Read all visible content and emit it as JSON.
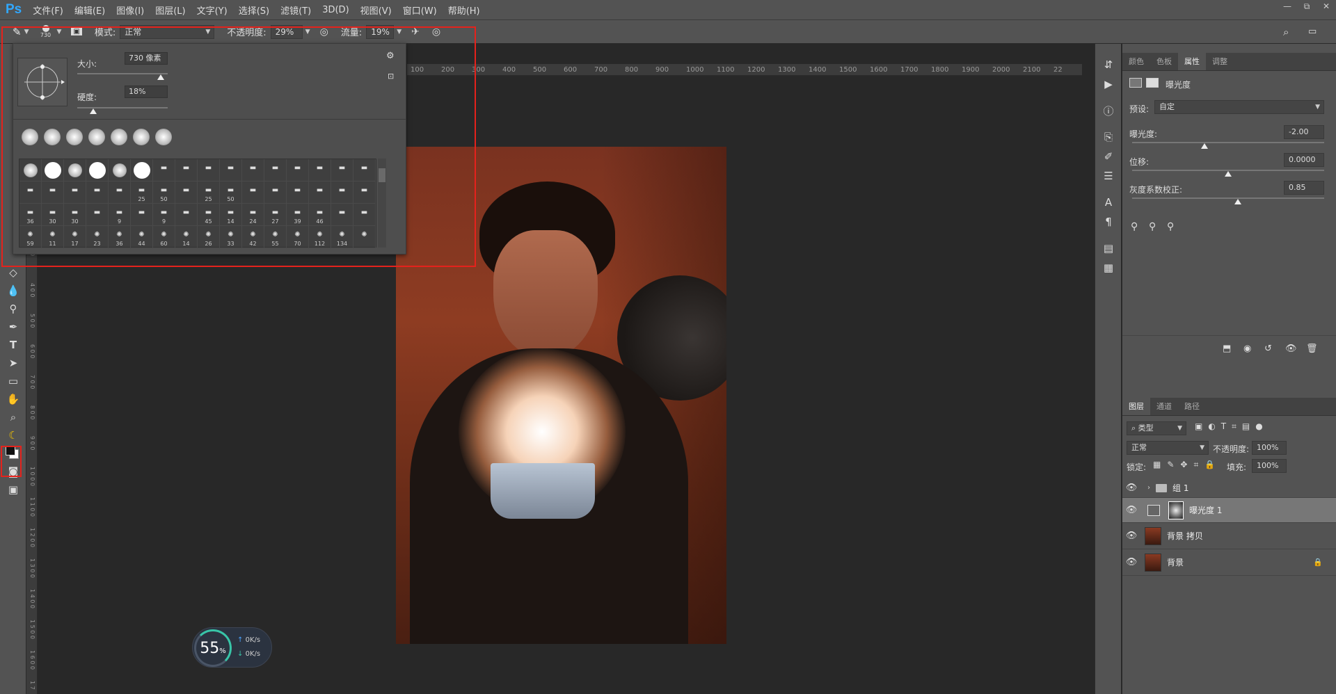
{
  "app": {
    "logo": "Ps",
    "menus": [
      "文件(F)",
      "编辑(E)",
      "图像(I)",
      "图层(L)",
      "文字(Y)",
      "选择(S)",
      "滤镜(T)",
      "3D(D)",
      "视图(V)",
      "窗口(W)",
      "帮助(H)"
    ],
    "win_controls": [
      "—",
      "⧉",
      "✕"
    ]
  },
  "options": {
    "brush_size": "730",
    "mode_label": "模式:",
    "mode_value": "正常",
    "opacity_label": "不透明度:",
    "opacity_value": "29%",
    "flow_label": "流量:",
    "flow_value": "19%"
  },
  "brush_popup": {
    "size_label": "大小:",
    "size_value": "730 像素",
    "hardness_label": "硬度:",
    "hardness_value": "18%",
    "size_level": 0.92,
    "hardness_level": 0.18,
    "brush_numbers": [
      "",
      "",
      "",
      "",
      "",
      "",
      "",
      "",
      "",
      "",
      "",
      "",
      "",
      "",
      "",
      "",
      "",
      "",
      "",
      "",
      "",
      "25",
      "50",
      "",
      "25",
      "50",
      "",
      "",
      "",
      "",
      "",
      "",
      "36",
      "30",
      "30",
      "",
      "9",
      "",
      "9",
      "",
      "45",
      "14",
      "24",
      "27",
      "39",
      "46",
      "",
      "",
      "59",
      "11",
      "17",
      "23",
      "36",
      "44",
      "60",
      "14",
      "26",
      "33",
      "42",
      "55",
      "70",
      "112",
      "134",
      ""
    ]
  },
  "ruler_top": [
    "100",
    "200",
    "300",
    "400",
    "500",
    "600",
    "700",
    "800",
    "900",
    "1000",
    "1100",
    "1200",
    "1300",
    "1400",
    "1500",
    "1600",
    "1700",
    "1800",
    "1900",
    "2000",
    "2100",
    "22"
  ],
  "ruler_left": [
    "0",
    "4 0 0",
    "5 0 0",
    "6 0 0",
    "7 0 0",
    "8 0 0",
    "9 0 0",
    "1 0 0 0",
    "1 1 0 0",
    "1 2 0 0",
    "1 3 0 0",
    "1 4 0 0",
    "1 5 0 0",
    "1 6 0 0",
    "1 7"
  ],
  "properties": {
    "tabs": [
      "颜色",
      "色板",
      "属性",
      "调整"
    ],
    "title": "曝光度",
    "preset_label": "预设:",
    "preset_value": "自定",
    "exposure_label": "曝光度:",
    "exposure_value": "-2.00",
    "exposure_level": 0.375,
    "offset_label": "位移:",
    "offset_value": "0.0000",
    "offset_level": 0.5,
    "gamma_label": "灰度系数校正:",
    "gamma_value": "0.85",
    "gamma_level": 0.55
  },
  "layers_panel": {
    "tabs": [
      "图层",
      "通道",
      "路径"
    ],
    "filter_label": "类型",
    "blend_value": "正常",
    "opacity_label": "不透明度:",
    "opacity_value": "100%",
    "lock_label": "锁定:",
    "fill_label": "填充:",
    "fill_value": "100%",
    "layers": [
      {
        "name": "组 1"
      },
      {
        "name": "曝光度 1"
      },
      {
        "name": "背景 拷贝"
      },
      {
        "name": "背景"
      }
    ]
  },
  "speed_widget": {
    "percent": "55",
    "unit": "%",
    "up": "0K/s",
    "down": "0K/s"
  }
}
